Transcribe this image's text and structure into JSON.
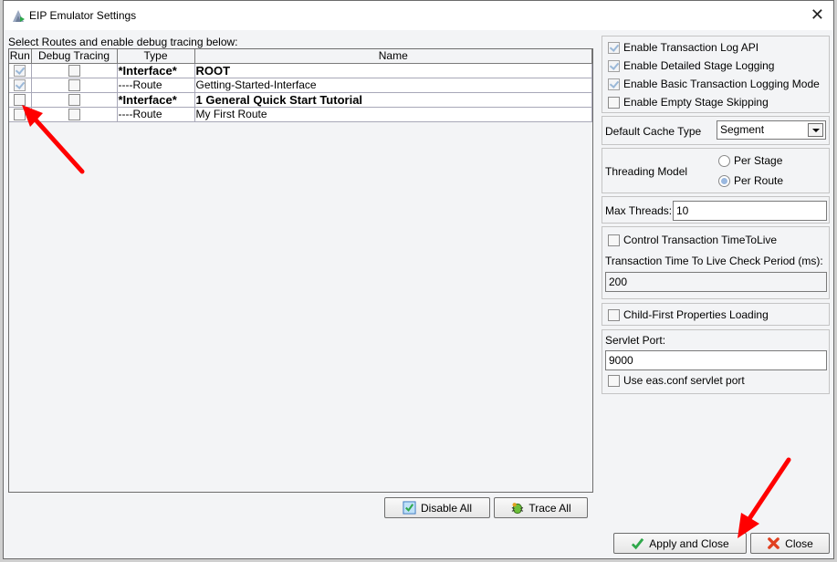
{
  "window": {
    "title": "EIP Emulator Settings",
    "app_icon": "app-icon",
    "close_icon": "close-icon"
  },
  "routes": {
    "instruction": "Select Routes and enable debug tracing below:",
    "columns": [
      "Run",
      "Debug Tracing",
      "Type",
      "Name"
    ],
    "rows": [
      {
        "run": true,
        "debug": false,
        "type": "*Interface*",
        "name": "ROOT",
        "bold": true
      },
      {
        "run": true,
        "debug": false,
        "type": "----Route",
        "name": "Getting-Started-Interface",
        "bold": false
      },
      {
        "run": false,
        "debug": false,
        "type": "*Interface*",
        "name": "1 General Quick Start Tutorial",
        "bold": true
      },
      {
        "run": false,
        "debug": false,
        "type": "----Route",
        "name": "My First Route",
        "bold": false
      }
    ],
    "disable_all_label": "Disable All",
    "trace_all_label": "Trace All"
  },
  "settings": {
    "logging": [
      {
        "label": "Enable Transaction Log API",
        "checked": true
      },
      {
        "label": "Enable Detailed Stage Logging",
        "checked": true
      },
      {
        "label": "Enable Basic Transaction Logging Mode",
        "checked": true
      },
      {
        "label": "Enable Empty Stage Skipping",
        "checked": false
      }
    ],
    "cache_type_label": "Default Cache Type",
    "cache_type_value": "Segment",
    "threading_label": "Threading Model",
    "threading_options": [
      {
        "label": "Per Stage",
        "selected": false
      },
      {
        "label": "Per Route",
        "selected": true
      }
    ],
    "max_threads_label": "Max Threads:",
    "max_threads_value": "10",
    "ttl_checkbox_label": "Control Transaction TimeToLive",
    "ttl_checked": false,
    "ttl_period_label": "Transaction Time To Live Check Period (ms):",
    "ttl_period_value": "200",
    "child_first_label": "Child-First Properties Loading",
    "child_first_checked": false,
    "servlet_port_label": "Servlet Port:",
    "servlet_port_value": "9000",
    "use_eas_label": "Use eas.conf servlet port",
    "use_eas_checked": false
  },
  "footer": {
    "apply_label": "Apply and Close",
    "close_label": "Close"
  },
  "annotations": {
    "arrow_color": "#ff0000"
  }
}
